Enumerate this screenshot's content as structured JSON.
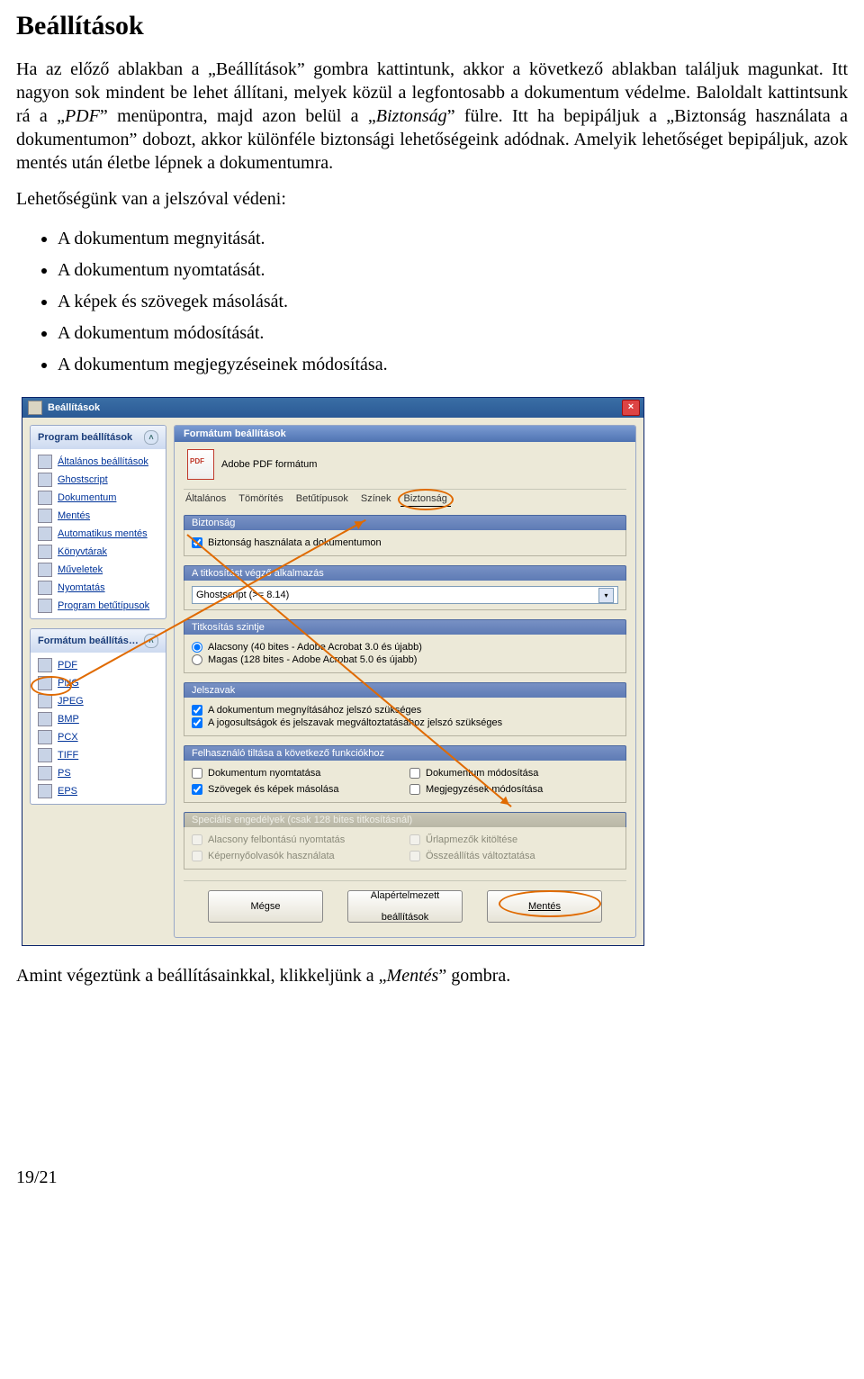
{
  "heading": "Beállítások",
  "para1_a": "Ha az előző ablakban a „Beállítások” gombra kattintunk, akkor a következő ablakban találjuk magunkat. Itt nagyon sok mindent be lehet állítani, melyek közül a legfontosabb a dokumentum védelme. Baloldalt kattintsunk rá a „",
  "para1_i1": "PDF",
  "para1_b": "” menüpontra, majd azon belül a „",
  "para1_i2": "Biztonság",
  "para1_c": "” fülre. Itt ha bepipáljuk a „Biztonság használata a dokumentumon” dobozt, akkor különféle biztonsági lehetőségeink adódnak. Amelyik lehetőséget bepipáljuk, azok mentés után életbe lépnek a dokumentumra.",
  "para2": "Lehetőségünk van a jelszóval védeni:",
  "bullets": {
    "b1": "A dokumentum megnyitását.",
    "b2": "A dokumentum nyomtatását.",
    "b3": "A képek és szövegek másolását.",
    "b4": "A dokumentum módosítását.",
    "b5": "A dokumentum megjegyzéseinek módosítása."
  },
  "para3_a": "Amint végeztünk a beállításainkkal, klikkeljünk a „",
  "para3_i": "Mentés",
  "para3_b": "” gombra.",
  "pagenum": "19/21",
  "dialog": {
    "title": "Beállítások",
    "sidebar": {
      "panel1": "Program beállítások",
      "items1": {
        "i1": "Általános beállítások",
        "i2": "Ghostscript",
        "i3": "Dokumentum",
        "i4": "Mentés",
        "i5": "Automatikus mentés",
        "i6": "Könyvtárak",
        "i7": "Műveletek",
        "i8": "Nyomtatás",
        "i9": "Program betűtípusok"
      },
      "panel2": "Formátum beállítás…",
      "items2": {
        "f1": "PDF",
        "f2": "PNG",
        "f3": "JPEG",
        "f4": "BMP",
        "f5": "PCX",
        "f6": "TIFF",
        "f7": "PS",
        "f8": "EPS"
      }
    },
    "content": {
      "section": "Formátum beállítások",
      "format_label": "Adobe PDF formátum",
      "tabs": {
        "t1": "Általános",
        "t2": "Tömörítés",
        "t3": "Betűtípusok",
        "t4": "Színek",
        "t5": "Biztonság"
      },
      "group_security": "Biztonság",
      "cb_use_security": "Biztonság használata a dokumentumon",
      "group_encrypt_app": "A titkosítást végző alkalmazás",
      "dd_ghostscript": "Ghostscript (>= 8.14)",
      "group_enc_level": "Titkosítás szintje",
      "r_low": "Alacsony (40 bites - Adobe Acrobat 3.0 és újabb)",
      "r_high": "Magas (128 bites - Adobe Acrobat 5.0 és újabb)",
      "group_passwords": "Jelszavak",
      "cb_pw_open": "A dokumentum megnyításához jelszó szükséges",
      "cb_pw_perm": "A jogosultságok és jelszavak megváltoztatásához jelszó szükséges",
      "group_disable": "Felhasználó tiltása a következő funkciókhoz",
      "cb_d1": "Dokumentum nyomtatása",
      "cb_d2": "Szövegek és képek másolása",
      "cb_d3": "Dokumentum módosítása",
      "cb_d4": "Megjegyzések módosítása",
      "group_special": "Speciális engedélyek (csak 128 bites titkosításnál)",
      "cb_s1": "Alacsony felbontású nyomtatás",
      "cb_s2": "Képernyőolvasók használata",
      "cb_s3": "Űrlapmezők kitöltése",
      "cb_s4": "Összeállítás változtatása"
    },
    "buttons": {
      "cancel": "Mégse",
      "default1": "Alapértelmezett",
      "default2": "beállítások",
      "save": "Mentés"
    }
  }
}
